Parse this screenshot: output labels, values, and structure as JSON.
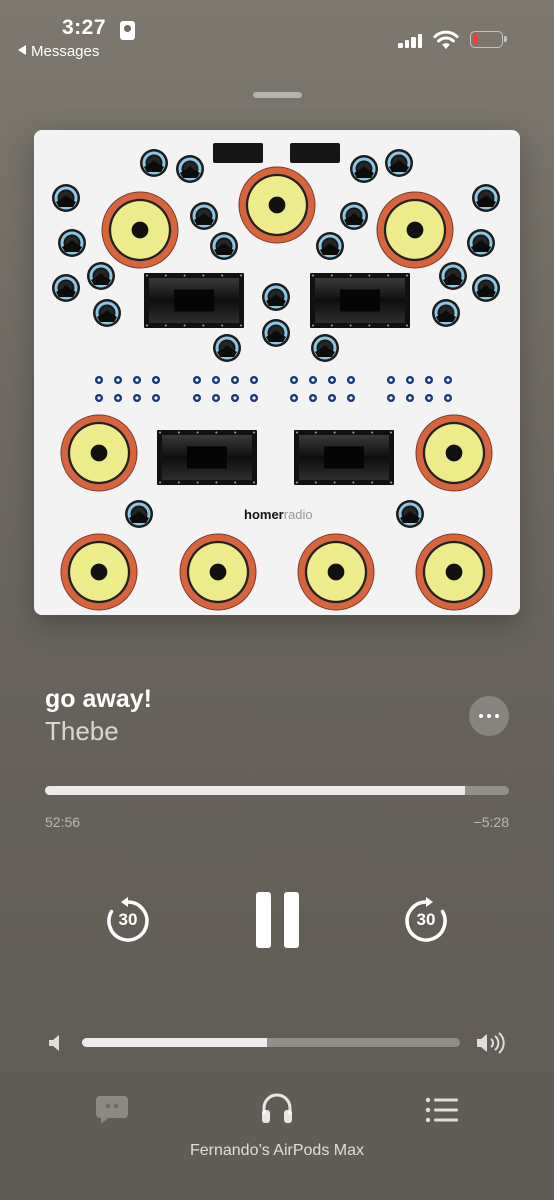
{
  "status_bar": {
    "time": "3:27",
    "back_label": "Messages",
    "battery_level": 0.2,
    "battery_color": "#ff3b30"
  },
  "artwork": {
    "brand": "homerradio",
    "brand_bold": "homer",
    "brand_light": "radio"
  },
  "now_playing": {
    "title": "go away!",
    "artist": "Thebe"
  },
  "progress": {
    "elapsed": "52:56",
    "remaining": "−5:28",
    "fraction": 0.906
  },
  "controls": {
    "skip_back_seconds": "30",
    "skip_forward_seconds": "30",
    "state": "playing"
  },
  "volume": {
    "level": 0.49
  },
  "bottom_bar": {
    "device_name": "Fernando’s AirPods Max",
    "icons": [
      "lyrics-icon",
      "airplay-headphones-icon",
      "queue-icon"
    ]
  },
  "colors": {
    "woofer_ring": "#d6653f",
    "woofer_cone": "#ecec8a",
    "tweeter": "#8cc7e6",
    "horn": "#1e1e1e",
    "artwork_bg": "#f3f3f3"
  }
}
